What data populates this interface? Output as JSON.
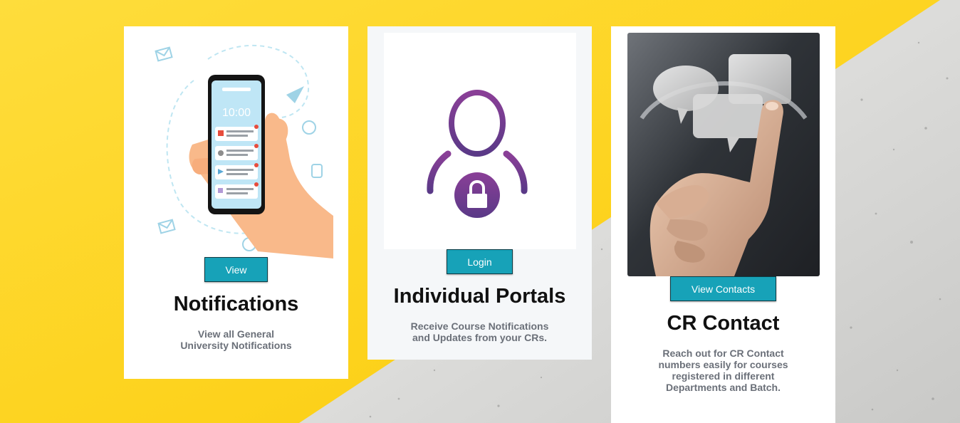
{
  "cards": [
    {
      "title": "Notifications",
      "button_label": "View",
      "description_lines": [
        "View all General",
        "University Notifications"
      ],
      "phone_time": "10:00"
    },
    {
      "title": "Individual Portals",
      "button_label": "Login",
      "description_lines": [
        "Receive Course Notifications",
        "and Updates from your CRs."
      ]
    },
    {
      "title": "CR Contact",
      "button_label": "View Contacts",
      "description_lines": [
        "Reach out for CR Contact",
        "numbers easily for courses",
        "registered in different",
        "Departments and Batch."
      ]
    }
  ],
  "colors": {
    "yellow_background": "#fdd21e",
    "concrete_background": "#d3d3d1",
    "button": "#17a2b8",
    "title_text": "#111111",
    "description_text": "#6b7079",
    "user_icon_purple": "#6e3a8e"
  }
}
